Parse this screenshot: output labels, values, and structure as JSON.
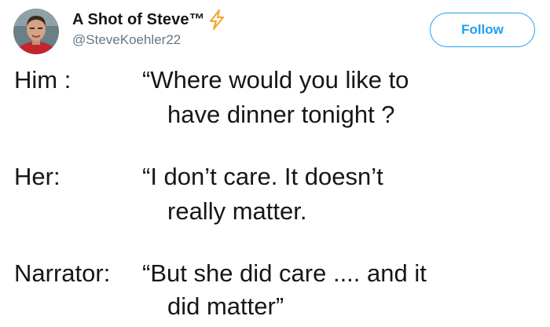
{
  "header": {
    "display_name": "A Shot of Steve™",
    "handle": "@SteveKoehler22",
    "follow_label": "Follow",
    "accent_color": "#1da1f2",
    "verified_icon": "lightning-bolt-icon"
  },
  "dialogue": [
    {
      "speaker": "Him :",
      "line1": "“Where would you like to",
      "line2": "have dinner tonight ?"
    },
    {
      "speaker": "Her:",
      "line1": "“I don’t care.  It doesn’t",
      "line2": "really matter."
    },
    {
      "speaker": "Narrator:",
      "line1": "“But she did care .... and it",
      "line2": "did matter”"
    }
  ]
}
